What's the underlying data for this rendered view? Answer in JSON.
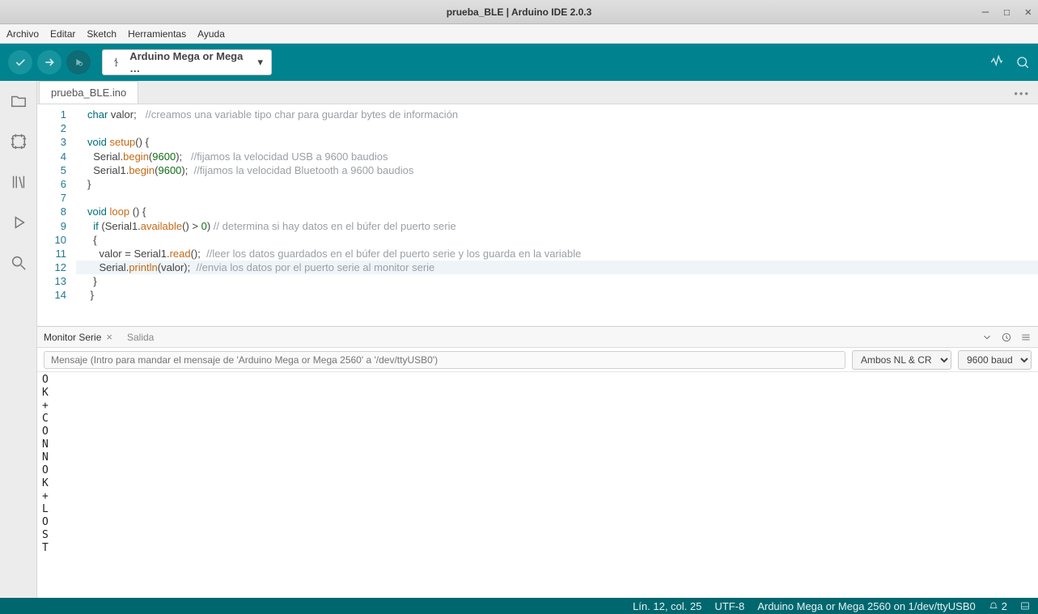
{
  "window_title": "prueba_BLE | Arduino IDE 2.0.3",
  "menus": [
    "Archivo",
    "Editar",
    "Sketch",
    "Herramientas",
    "Ayuda"
  ],
  "board_label": "Arduino Mega or Mega …",
  "tab": "prueba_BLE.ino",
  "code": [
    [
      [
        "t",
        "char"
      ],
      [
        " "
      ],
      [
        "id",
        "valor"
      ],
      [
        "p",
        ";   "
      ],
      [
        "c",
        "//creamos una variable tipo char para guardar bytes de información"
      ]
    ],
    [],
    [
      [
        "t",
        "void"
      ],
      [
        " "
      ],
      [
        "fn",
        "setup"
      ],
      [
        "p",
        "() {"
      ]
    ],
    [
      [
        "  "
      ],
      [
        "id",
        "Serial"
      ],
      [
        "p",
        "."
      ],
      [
        "fn",
        "begin"
      ],
      [
        "p",
        "("
      ],
      [
        "n",
        "9600"
      ],
      [
        "p",
        ");   "
      ],
      [
        "c",
        "//fijamos la velocidad USB a 9600 baudios"
      ]
    ],
    [
      [
        "  "
      ],
      [
        "id",
        "Serial1"
      ],
      [
        "p",
        "."
      ],
      [
        "fn",
        "begin"
      ],
      [
        "p",
        "("
      ],
      [
        "n",
        "9600"
      ],
      [
        "p",
        ");  "
      ],
      [
        "c",
        "//fijamos la velocidad Bluetooth a 9600 baudios"
      ]
    ],
    [
      [
        "p",
        "}"
      ]
    ],
    [],
    [
      [
        "t",
        "void"
      ],
      [
        " "
      ],
      [
        "fn",
        "loop"
      ],
      [
        " "
      ],
      [
        "p",
        "() {"
      ]
    ],
    [
      [
        "  "
      ],
      [
        "k",
        "if"
      ],
      [
        " "
      ],
      [
        "p",
        "("
      ],
      [
        "id",
        "Serial1"
      ],
      [
        "p",
        "."
      ],
      [
        "fn",
        "available"
      ],
      [
        "p",
        "() > "
      ],
      [
        "n",
        "0"
      ],
      [
        "p",
        ") "
      ],
      [
        "c",
        "// determina si hay datos en el búfer del puerto serie"
      ]
    ],
    [
      [
        "p",
        "  {"
      ]
    ],
    [
      [
        "    "
      ],
      [
        "id",
        "valor"
      ],
      [
        "p",
        " = "
      ],
      [
        "id",
        "Serial1"
      ],
      [
        "p",
        "."
      ],
      [
        "fn",
        "read"
      ],
      [
        "p",
        "();  "
      ],
      [
        "c",
        "//leer los datos guardados en el búfer del puerto serie y los guarda en la variable"
      ]
    ],
    [
      [
        "    "
      ],
      [
        "id",
        "Serial"
      ],
      [
        "p",
        "."
      ],
      [
        "fn",
        "println"
      ],
      [
        "p",
        "("
      ],
      [
        "id",
        "valor"
      ],
      [
        "p",
        ");  "
      ],
      [
        "c",
        "//envia los datos por el puerto serie al monitor serie"
      ]
    ],
    [
      [
        "p",
        "  }"
      ]
    ],
    [
      [
        "p",
        " }"
      ]
    ]
  ],
  "highlight_line": 12,
  "panel": {
    "tab1": "Monitor Serie",
    "tab2": "Salida"
  },
  "serial": {
    "placeholder": "Mensaje (Intro para mandar el mensaje de 'Arduino Mega or Mega 2560' a '/dev/ttyUSB0')",
    "line_ending": "Ambos NL & CR",
    "baud": "9600 baud",
    "output": [
      "O",
      "K",
      "+",
      "C",
      "O",
      "N",
      "N",
      "O",
      "K",
      "+",
      "L",
      "O",
      "S",
      "T"
    ]
  },
  "status": {
    "cursor": "Lín. 12, col. 25",
    "encoding": "UTF-8",
    "board": "Arduino Mega or Mega 2560 on 1/dev/ttyUSB0",
    "notif": "2"
  }
}
